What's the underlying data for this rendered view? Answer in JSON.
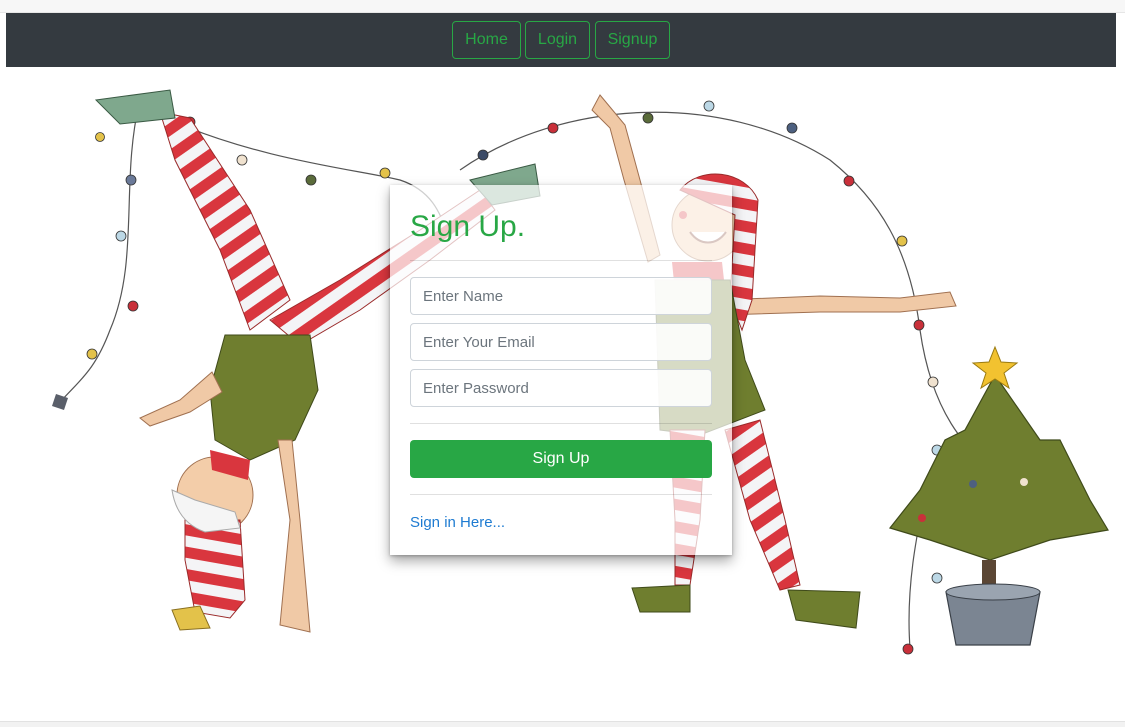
{
  "nav": {
    "items": [
      {
        "label": "Home"
      },
      {
        "label": "Login"
      },
      {
        "label": "Signup"
      }
    ]
  },
  "form": {
    "title": "Sign Up.",
    "name_placeholder": "Enter Name",
    "email_placeholder": "Enter Your Email",
    "password_placeholder": "Enter Password",
    "submit_label": "Sign Up",
    "signin_link": "Sign in Here..."
  },
  "colors": {
    "navbar": "#343a40",
    "accent_green": "#28a745",
    "link_blue": "#1e7bd1"
  },
  "illustration": {
    "subject": "elves-with-christmas-lights-and-tree"
  }
}
